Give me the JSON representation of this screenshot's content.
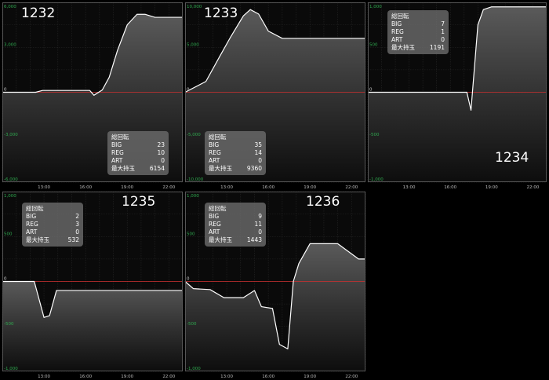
{
  "chart_data": [
    {
      "type": "area",
      "machine_title": "1232",
      "x_ticks": [
        "13:00",
        "16:00",
        "19:00",
        "22:00"
      ],
      "y_ticks": [
        "6,000",
        "3,000",
        "0",
        "-3,000",
        "-6,000"
      ],
      "ylim": [
        -6000,
        6000
      ],
      "xlim": [
        10,
        23
      ],
      "grid": true,
      "legend_position": "bottom-right",
      "legend": {
        "header": "総回転",
        "rows": [
          [
            "BIG",
            "23"
          ],
          [
            "REG",
            "10"
          ],
          [
            "ART",
            "0"
          ],
          [
            "最大持玉",
            "6154"
          ]
        ]
      },
      "x": [
        10,
        12.4,
        12.9,
        16.3,
        16.6,
        17.2,
        17.7,
        18.3,
        19.0,
        19.7,
        20.3,
        21.0,
        23
      ],
      "y": [
        0,
        0,
        120,
        120,
        -200,
        150,
        1000,
        2800,
        4500,
        5200,
        5200,
        5000,
        5000
      ]
    },
    {
      "type": "area",
      "machine_title": "1233",
      "x_ticks": [
        "13:00",
        "16:00",
        "19:00",
        "22:00"
      ],
      "y_ticks": [
        "10,000",
        "5,000",
        "0",
        "-5,000",
        "-10,000"
      ],
      "ylim": [
        -10000,
        10000
      ],
      "xlim": [
        10,
        23
      ],
      "grid": true,
      "legend_position": "bottom-left",
      "legend": {
        "header": "総回転",
        "rows": [
          [
            "BIG",
            "35"
          ],
          [
            "REG",
            "14"
          ],
          [
            "ART",
            "0"
          ],
          [
            "最大持玉",
            "9360"
          ]
        ]
      },
      "x": [
        10,
        11.5,
        12.5,
        13.3,
        14.2,
        14.7,
        15.3,
        16.0,
        17.0,
        17.8,
        23
      ],
      "y": [
        0,
        1200,
        4000,
        6200,
        8500,
        9200,
        8700,
        6800,
        6000,
        6000,
        6000
      ]
    },
    {
      "type": "area",
      "machine_title": "1234",
      "x_ticks": [
        "13:00",
        "16:00",
        "19:00",
        "22:00"
      ],
      "y_ticks": [
        "1,000",
        "500",
        "0",
        "-500",
        "-1,000"
      ],
      "ylim": [
        -1000,
        1000
      ],
      "xlim": [
        10,
        23
      ],
      "grid": true,
      "legend_position": "top-left",
      "legend": {
        "header": "総回転",
        "rows": [
          [
            "BIG",
            "7"
          ],
          [
            "REG",
            "1"
          ],
          [
            "ART",
            "0"
          ],
          [
            "最大持玉",
            "1191"
          ]
        ]
      },
      "x": [
        10,
        17.2,
        17.5,
        18.0,
        18.4,
        19.0,
        19.4,
        23
      ],
      "y": [
        0,
        0,
        -200,
        750,
        920,
        950,
        950,
        950
      ]
    },
    {
      "type": "area",
      "machine_title": "1235",
      "x_ticks": [
        "13:00",
        "16:00",
        "19:00",
        "22:00"
      ],
      "y_ticks": [
        "1,000",
        "500",
        "0",
        "-500",
        "-1,000"
      ],
      "ylim": [
        -1000,
        1000
      ],
      "xlim": [
        10,
        23
      ],
      "grid": true,
      "legend_position": "top-left",
      "legend": {
        "header": "総回転",
        "rows": [
          [
            "BIG",
            "2"
          ],
          [
            "REG",
            "3"
          ],
          [
            "ART",
            "0"
          ],
          [
            "最大持玉",
            "532"
          ]
        ]
      },
      "x": [
        10,
        12.3,
        13.0,
        13.4,
        13.9,
        23
      ],
      "y": [
        0,
        0,
        -400,
        -380,
        -100,
        -100
      ]
    },
    {
      "type": "area",
      "machine_title": "1236",
      "x_ticks": [
        "13:00",
        "16:00",
        "19:00",
        "22:00"
      ],
      "y_ticks": [
        "1,000",
        "500",
        "0",
        "-500",
        "-1,000"
      ],
      "ylim": [
        -1000,
        1000
      ],
      "xlim": [
        10,
        23
      ],
      "grid": true,
      "legend_position": "top-left",
      "legend": {
        "header": "総回転",
        "rows": [
          [
            "BIG",
            "9"
          ],
          [
            "REG",
            "11"
          ],
          [
            "ART",
            "0"
          ],
          [
            "最大持玉",
            "1443"
          ]
        ]
      },
      "x": [
        10,
        10.6,
        11.8,
        12.8,
        14.2,
        15.0,
        15.5,
        16.3,
        16.8,
        17.4,
        17.8,
        18.2,
        19.0,
        21.0,
        22.5,
        23
      ],
      "y": [
        0,
        -80,
        -90,
        -180,
        -180,
        -100,
        -280,
        -300,
        -700,
        -750,
        0,
        200,
        420,
        420,
        250,
        250
      ]
    }
  ]
}
